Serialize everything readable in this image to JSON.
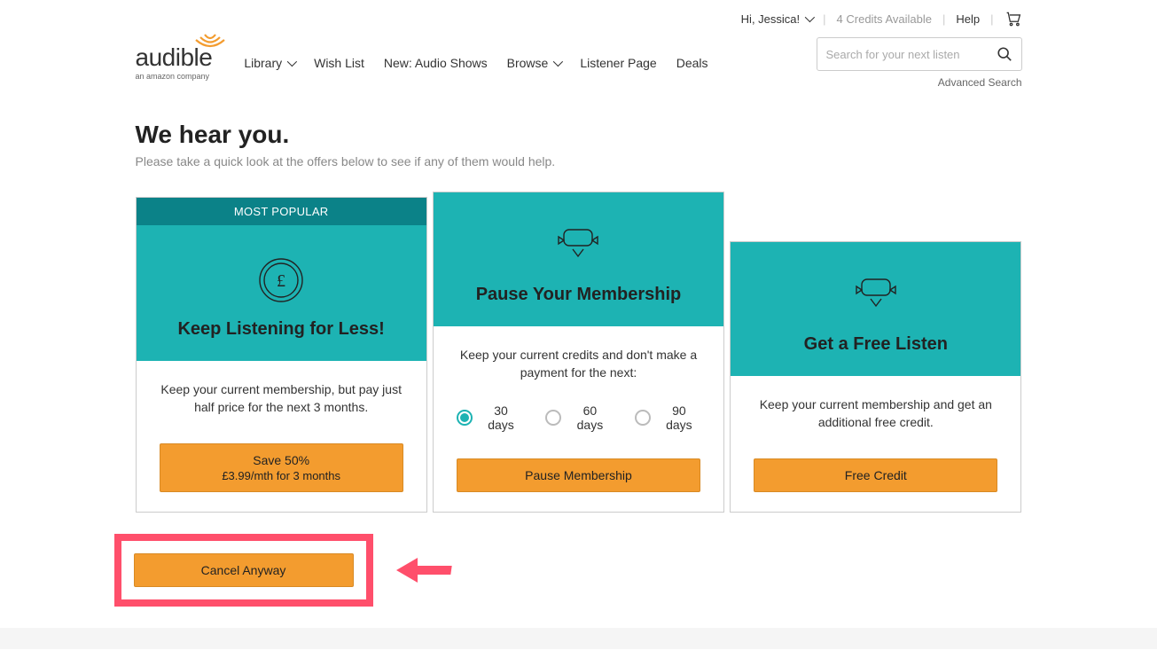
{
  "topbar": {
    "greeting": "Hi, Jessica!",
    "credits": "4 Credits Available",
    "help": "Help"
  },
  "logo": {
    "main": "audible",
    "sub": "an amazon company"
  },
  "nav": {
    "library": "Library",
    "wishlist": "Wish List",
    "audioshows": "New: Audio Shows",
    "browse": "Browse",
    "listenerpage": "Listener Page",
    "deals": "Deals"
  },
  "search": {
    "placeholder": "Search for your next listen",
    "advanced": "Advanced Search"
  },
  "page": {
    "title": "We hear you.",
    "subtitle": "Please take a quick look at the offers below to see if any of them would help."
  },
  "cards": [
    {
      "badge": "MOST POPULAR",
      "title": "Keep Listening for Less!",
      "desc": "Keep your current membership, but pay just half price for the next 3 months.",
      "button_line1": "Save 50%",
      "button_line2": "£3.99/mth for 3 months"
    },
    {
      "title": "Pause Your Membership",
      "desc": "Keep your current credits and don't make a payment for the next:",
      "options": [
        "30 days",
        "60 days",
        "90 days"
      ],
      "selected": 0,
      "button_line1": "Pause Membership"
    },
    {
      "title": "Get a Free Listen",
      "desc": "Keep your current membership and get an additional free credit.",
      "button_line1": "Free Credit"
    }
  ],
  "cancel": {
    "label": "Cancel Anyway"
  }
}
